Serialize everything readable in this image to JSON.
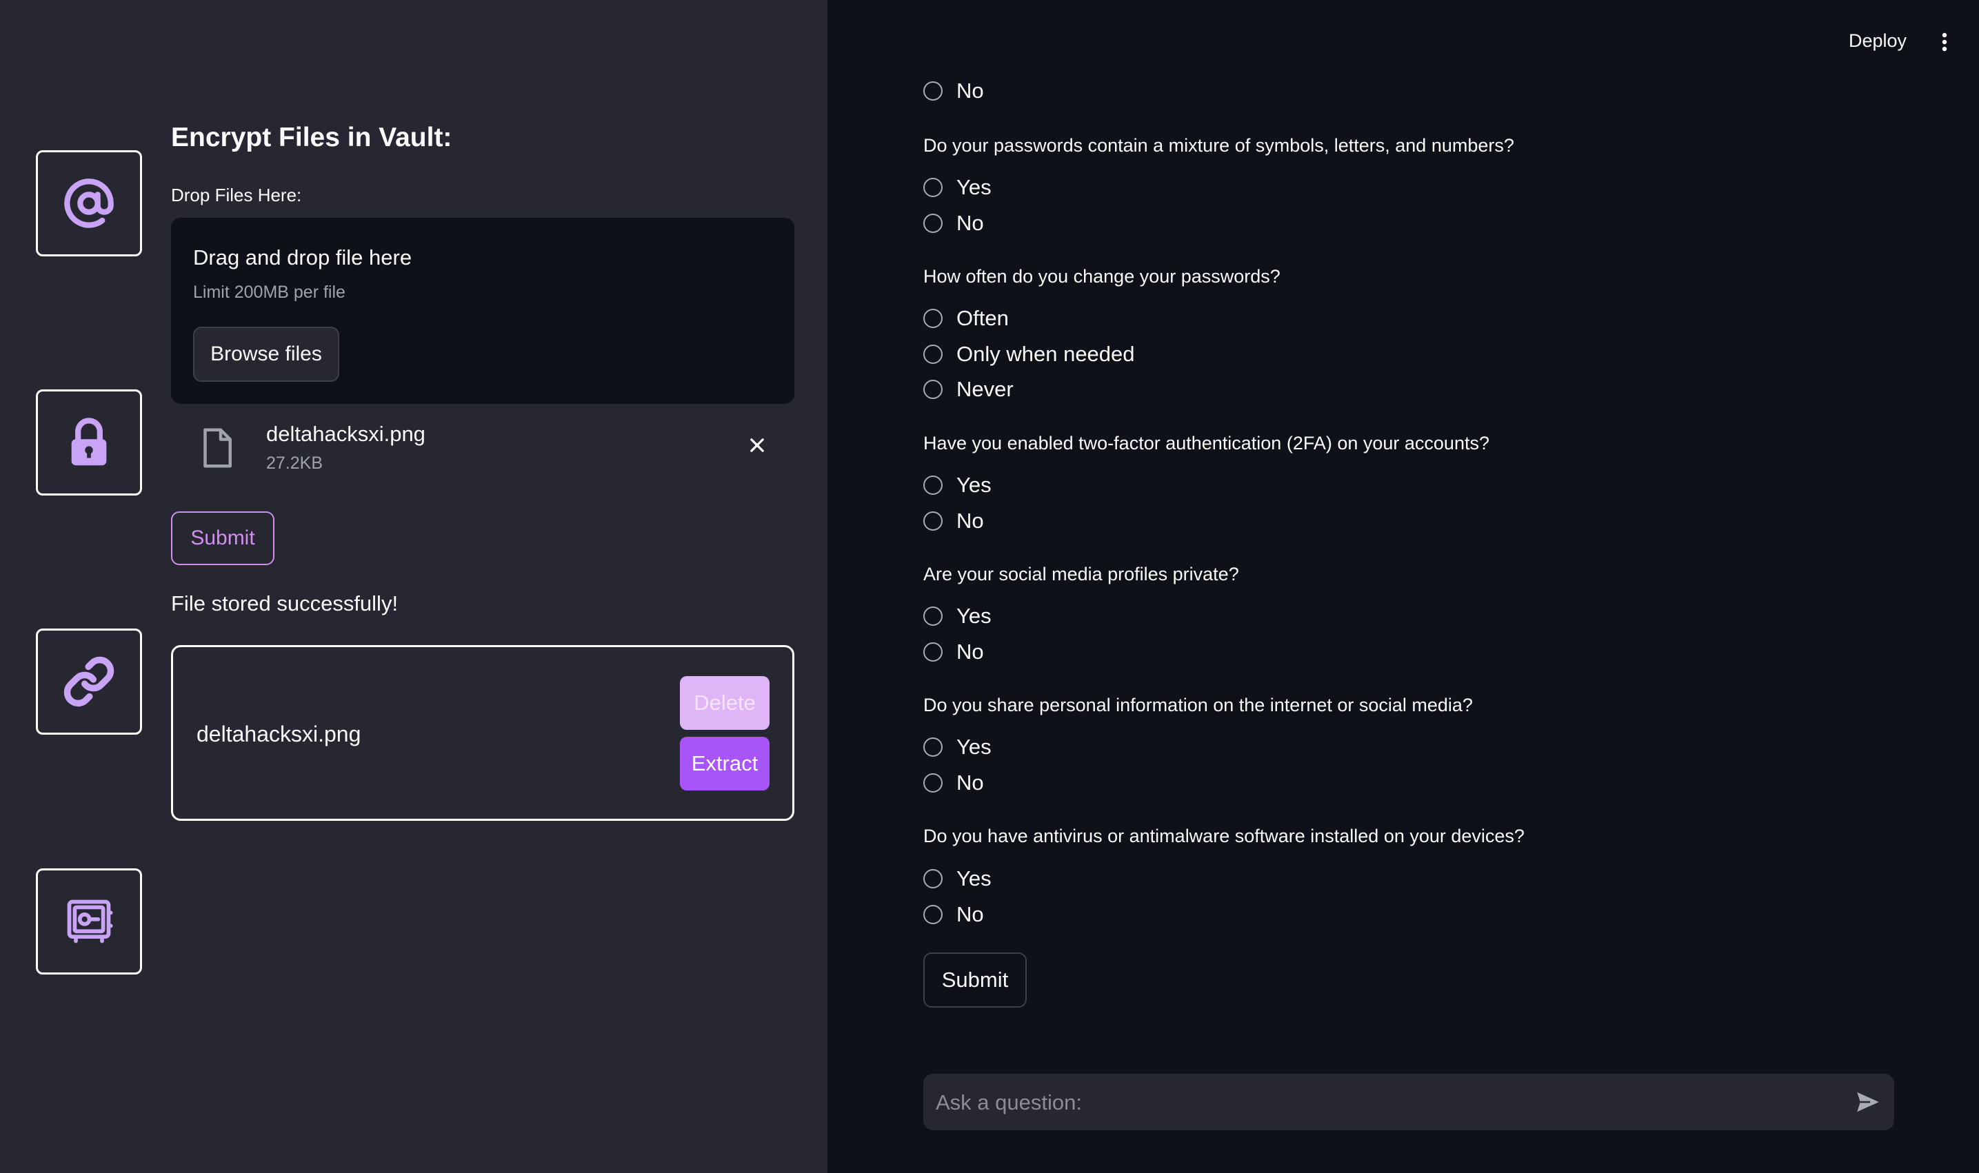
{
  "sidebar": {
    "nav": [
      {
        "icon": "at-sign-icon"
      },
      {
        "icon": "lock-icon"
      },
      {
        "icon": "link-icon"
      },
      {
        "icon": "vault-safe-icon"
      }
    ],
    "title": "Encrypt Files in Vault:",
    "drop_label": "Drop Files Here:",
    "dropzone": {
      "text": "Drag and drop file here",
      "limit": "Limit 200MB per file",
      "browse_label": "Browse files"
    },
    "uploaded_file": {
      "name": "deltahacksxi.png",
      "size": "27.2KB"
    },
    "submit_label": "Submit",
    "status": "File stored successfully!",
    "vault_item": {
      "name": "deltahacksxi.png",
      "delete_label": "Delete",
      "extract_label": "Extract"
    }
  },
  "header": {
    "deploy_label": "Deploy"
  },
  "quiz": {
    "top_option": "No",
    "questions": [
      {
        "text": "Do your passwords contain a mixture of symbols, letters, and numbers?",
        "options": [
          "Yes",
          "No"
        ]
      },
      {
        "text": "How often do you change your passwords?",
        "options": [
          "Often",
          "Only when needed",
          "Never"
        ]
      },
      {
        "text": "Have you enabled two-factor authentication (2FA) on your accounts?",
        "options": [
          "Yes",
          "No"
        ]
      },
      {
        "text": "Are your social media profiles private?",
        "options": [
          "Yes",
          "No"
        ]
      },
      {
        "text": "Do you share personal information on the internet or social media?",
        "options": [
          "Yes",
          "No"
        ]
      },
      {
        "text": "Do you have antivirus or antimalware software installed on your devices?",
        "options": [
          "Yes",
          "No"
        ]
      }
    ],
    "submit_label": "Submit"
  },
  "chat": {
    "placeholder": "Ask a question:"
  },
  "colors": {
    "accent": "#a855f7",
    "icon": "#c9a3f5",
    "sidebar_bg": "#262730",
    "main_bg": "#0e1117"
  }
}
